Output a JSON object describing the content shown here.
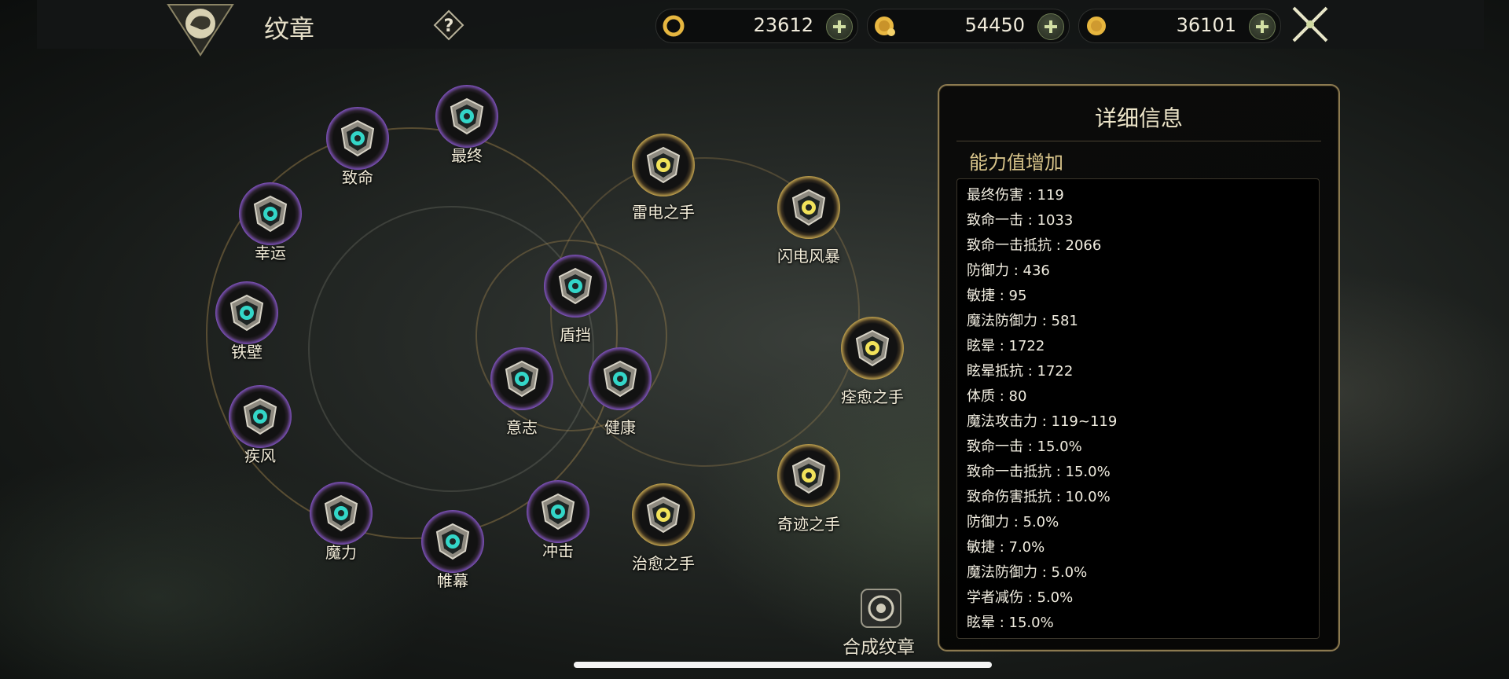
{
  "header": {
    "title": "纹章",
    "help_symbol": "?",
    "resources": [
      {
        "icon": "refresh-coin-icon",
        "value": "23612"
      },
      {
        "icon": "gold-coin-bag-icon",
        "value": "54450"
      },
      {
        "icon": "gold-coin-icon",
        "value": "36101"
      }
    ],
    "close_icon": "crossed-swords-close-icon"
  },
  "emblems": [
    {
      "label": "最终",
      "frame": "purple"
    },
    {
      "label": "致命",
      "frame": "purple"
    },
    {
      "label": "幸运",
      "frame": "purple"
    },
    {
      "label": "铁壁",
      "frame": "purple"
    },
    {
      "label": "疾风",
      "frame": "purple"
    },
    {
      "label": "魔力",
      "frame": "purple"
    },
    {
      "label": "帷幕",
      "frame": "purple"
    },
    {
      "label": "冲击",
      "frame": "purple"
    },
    {
      "label": "盾挡",
      "frame": "purple"
    },
    {
      "label": "意志",
      "frame": "purple"
    },
    {
      "label": "健康",
      "frame": "purple"
    },
    {
      "label": "雷电之手",
      "frame": "gold"
    },
    {
      "label": "闪电风暴",
      "frame": "gold"
    },
    {
      "label": "痊愈之手",
      "frame": "gold"
    },
    {
      "label": "奇迹之手",
      "frame": "gold"
    },
    {
      "label": "治愈之手",
      "frame": "gold"
    }
  ],
  "details": {
    "title": "详细信息",
    "section": "能力值增加",
    "stats": [
      "最终伤害 : 119",
      "致命一击 : 1033",
      "致命一击抵抗 : 2066",
      "防御力 : 436",
      "敏捷 : 95",
      "魔法防御力 : 581",
      "眩晕 : 1722",
      "眩晕抵抗 : 1722",
      "体质 : 80",
      "魔法攻击力 : 119~119",
      "致命一击 : 15.0%",
      "致命一击抵抗 : 15.0%",
      "致命伤害抵抗 : 10.0%",
      "防御力 : 5.0%",
      "敏捷 : 7.0%",
      "魔法防御力 : 5.0%",
      "学者减伤 : 5.0%",
      "眩晕 : 15.0%"
    ]
  },
  "synthesize": {
    "label": "合成纹章",
    "icon": "emblem-synthesize-icon"
  },
  "colors": {
    "purple_frame": "#8f62c9",
    "gold_frame": "#e2c46c",
    "teal_glyph": "#33d6c8",
    "yellow_glyph": "#f1e25a"
  }
}
